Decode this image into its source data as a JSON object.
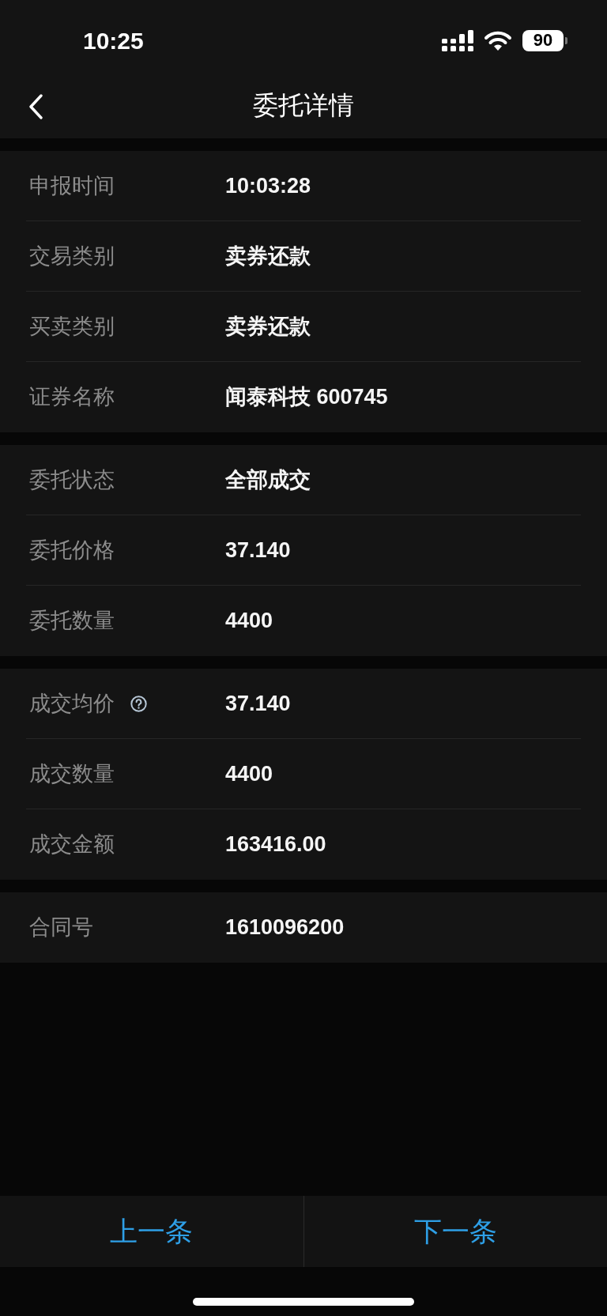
{
  "status_bar": {
    "time": "10:25",
    "battery": "90"
  },
  "header": {
    "title": "委托详情"
  },
  "sections": [
    {
      "rows": [
        {
          "label": "申报时间",
          "value": "10:03:28"
        },
        {
          "label": "交易类别",
          "value": "卖券还款"
        },
        {
          "label": "买卖类别",
          "value": "卖券还款"
        },
        {
          "label": "证券名称",
          "value": "闻泰科技 600745"
        }
      ]
    },
    {
      "rows": [
        {
          "label": "委托状态",
          "value": "全部成交"
        },
        {
          "label": "委托价格",
          "value": "37.140"
        },
        {
          "label": "委托数量",
          "value": "4400"
        }
      ]
    },
    {
      "rows": [
        {
          "label": "成交均价",
          "value": "37.140",
          "help_icon": true
        },
        {
          "label": "成交数量",
          "value": "4400"
        },
        {
          "label": "成交金额",
          "value": "163416.00"
        }
      ]
    },
    {
      "rows": [
        {
          "label": "合同号",
          "value": "1610096200"
        }
      ]
    }
  ],
  "footer": {
    "buttons": [
      "上一条",
      "下一条"
    ]
  }
}
